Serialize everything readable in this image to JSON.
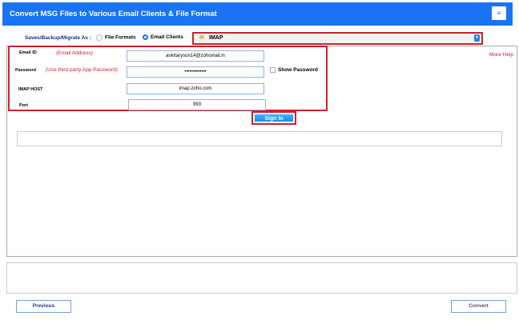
{
  "header": {
    "title": "Convert MSG Files to Various Email Clients & File Format",
    "menu_icon": "hamburger-icon",
    "brand_color": "#1a73f5"
  },
  "saveas": {
    "label": "Saves/Backup/Migrate As :",
    "options": [
      "File Formats",
      "Email Clients"
    ],
    "selected": "Email Clients"
  },
  "client_select": {
    "value": "IMAP",
    "icon": "imap-envelope-icon"
  },
  "form": {
    "email": {
      "label": "Email ID",
      "hint": "(Email Address)",
      "value": "ankitaryson14@zohomail.in"
    },
    "password": {
      "label": "Password",
      "hint": "(Use third party App Password)",
      "value": "•••••••••••••"
    },
    "show_password": "Show Password",
    "host": {
      "label": "IMAP HOST",
      "value": "imap.zoho.com"
    },
    "port": {
      "label": "Port",
      "value": "993"
    }
  },
  "more_help": "More Help",
  "sign_in": "Sign In",
  "footer": {
    "previous": "Previous",
    "convert": "Convert"
  },
  "accent_red": "#d0202c"
}
